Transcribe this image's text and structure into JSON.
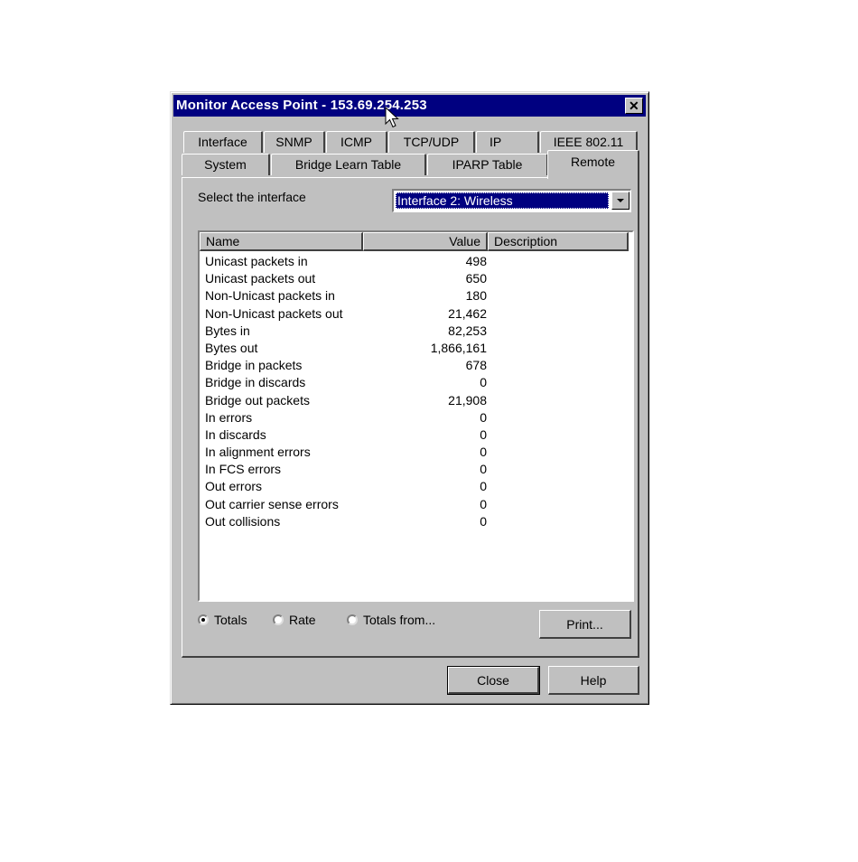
{
  "window": {
    "title": "Monitor Access Point - 153.69.254.253",
    "close_glyph": "✕"
  },
  "tabs_back": [
    "Interface",
    "SNMP",
    "ICMP",
    "TCP/UDP",
    "IP",
    "IEEE 802.11"
  ],
  "tabs_front": [
    "System",
    "Bridge Learn Table",
    "IPARP Table",
    "Remote"
  ],
  "active_tab": "Remote",
  "interface_select": {
    "label": "Select the interface",
    "value": "Interface 2: Wireless"
  },
  "table": {
    "columns": [
      "Name",
      "Value",
      "Description"
    ],
    "rows": [
      {
        "name": "Unicast packets in",
        "value": "498"
      },
      {
        "name": "Unicast packets out",
        "value": "650"
      },
      {
        "name": "Non-Unicast packets in",
        "value": "180"
      },
      {
        "name": "Non-Unicast packets out",
        "value": "21,462"
      },
      {
        "name": "Bytes in",
        "value": "82,253"
      },
      {
        "name": "Bytes out",
        "value": "1,866,161"
      },
      {
        "name": "Bridge in packets",
        "value": "678"
      },
      {
        "name": "Bridge in discards",
        "value": "0"
      },
      {
        "name": "Bridge out packets",
        "value": "21,908"
      },
      {
        "name": "In errors",
        "value": "0"
      },
      {
        "name": "In discards",
        "value": "0"
      },
      {
        "name": "In alignment errors",
        "value": "0"
      },
      {
        "name": "In FCS errors",
        "value": "0"
      },
      {
        "name": "Out errors",
        "value": "0"
      },
      {
        "name": "Out carrier sense errors",
        "value": "0"
      },
      {
        "name": "Out collisions",
        "value": "0"
      }
    ]
  },
  "radios": [
    {
      "label": "Totals",
      "checked": true
    },
    {
      "label": "Rate",
      "checked": false
    },
    {
      "label": "Totals from...",
      "checked": false
    }
  ],
  "buttons": {
    "print": "Print...",
    "close": "Close",
    "help": "Help"
  }
}
